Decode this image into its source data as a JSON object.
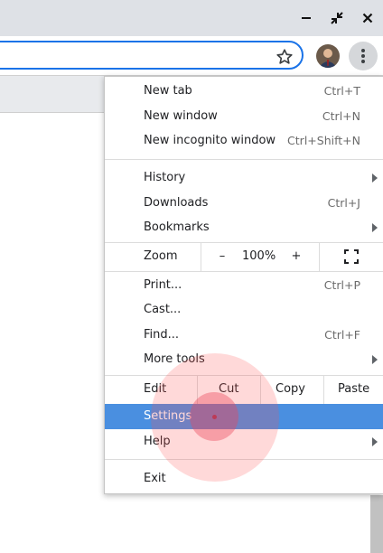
{
  "window": {
    "minimize_icon": "minimize-icon",
    "restore_icon": "restore-icon",
    "close_icon": "close-icon"
  },
  "toolbar": {
    "bookmark_icon": "star-icon",
    "profile": "avatar",
    "menu_icon": "kebab-menu-icon"
  },
  "menu": {
    "new_tab": {
      "label": "New tab",
      "shortcut": "Ctrl+T"
    },
    "new_window": {
      "label": "New window",
      "shortcut": "Ctrl+N"
    },
    "new_incognito": {
      "label": "New incognito window",
      "shortcut": "Ctrl+Shift+N"
    },
    "history": {
      "label": "History"
    },
    "downloads": {
      "label": "Downloads",
      "shortcut": "Ctrl+J"
    },
    "bookmarks": {
      "label": "Bookmarks"
    },
    "zoom": {
      "label": "Zoom",
      "minus": "–",
      "value": "100%",
      "plus": "+",
      "fullscreen_icon": "fullscreen-icon"
    },
    "print": {
      "label": "Print...",
      "shortcut": "Ctrl+P"
    },
    "cast": {
      "label": "Cast..."
    },
    "find": {
      "label": "Find...",
      "shortcut": "Ctrl+F"
    },
    "more_tools": {
      "label": "More tools"
    },
    "edit": {
      "label": "Edit",
      "cut": "Cut",
      "copy": "Copy",
      "paste": "Paste"
    },
    "settings": {
      "label": "Settings"
    },
    "help": {
      "label": "Help"
    },
    "exit": {
      "label": "Exit"
    }
  },
  "colors": {
    "highlight": "#4a8fe0",
    "accent": "#1a73e8",
    "click_marker": "#ff5050"
  }
}
